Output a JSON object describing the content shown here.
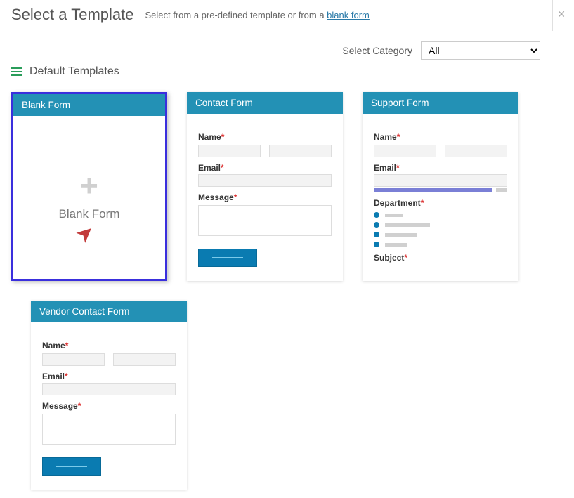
{
  "header": {
    "title": "Select a Template",
    "subtitle_pre": "Select from a pre-defined template or from a ",
    "subtitle_link": "blank form"
  },
  "category": {
    "label": "Select Category",
    "selected": "All",
    "options": [
      "All"
    ]
  },
  "section": {
    "title": "Default Templates"
  },
  "templates": [
    {
      "title": "Blank Form",
      "label": "Blank Form"
    },
    {
      "title": "Contact Form",
      "fields": {
        "name": "Name",
        "email": "Email",
        "message": "Message"
      }
    },
    {
      "title": "Support Form",
      "fields": {
        "name": "Name",
        "email": "Email",
        "department": "Department",
        "subject": "Subject"
      }
    },
    {
      "title": "Vendor Contact Form",
      "fields": {
        "name": "Name",
        "email": "Email",
        "message": "Message"
      }
    }
  ]
}
